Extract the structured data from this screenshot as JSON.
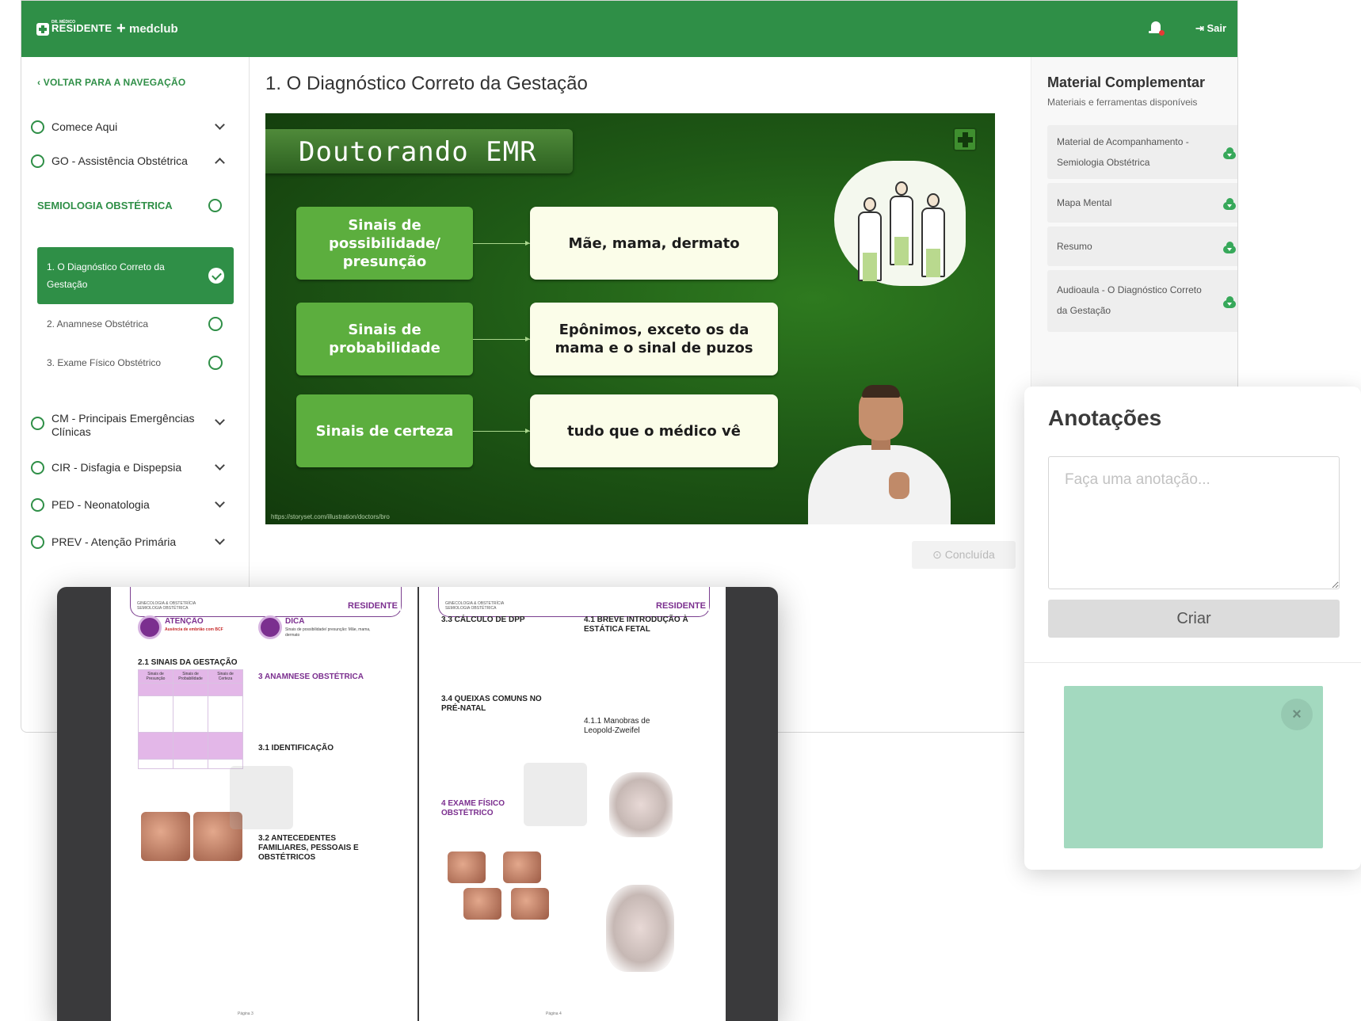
{
  "topbar": {
    "logo_small": "DR. MÉDICO",
    "logo": "RESIDENTE",
    "partner": "medclub",
    "logout": "Sair"
  },
  "sidebar": {
    "back": "VOLTAR PARA A NAVEGAÇÃO",
    "modules": [
      {
        "label": "Comece Aqui"
      },
      {
        "label": "GO - Assistência Obstétrica"
      },
      {
        "label": "CM - Principais Emergências Clínicas"
      },
      {
        "label": "CIR - Disfagia e Dispepsia"
      },
      {
        "label": "PED - Neonatologia"
      },
      {
        "label": "PREV - Atenção Primária"
      }
    ],
    "subsection": "SEMIOLOGIA OBSTÉTRICA",
    "lessons": [
      {
        "label": "1. O Diagnóstico Correto da Gestação",
        "status": "done"
      },
      {
        "label": "2. Anamnese Obstétrica",
        "status": "pending"
      },
      {
        "label": "3. Exame Físico Obstétrico",
        "status": "pending"
      }
    ]
  },
  "main": {
    "title": "1. O Diagnóstico Correto da Gestação",
    "done_button": "Concluída"
  },
  "video": {
    "banner": "Doutorando EMR",
    "rows": [
      {
        "left": "Sinais de possibilidade/ presunção",
        "right": "Mãe, mama, dermato"
      },
      {
        "left": "Sinais de probabilidade",
        "right": "Epônimos, exceto os da mama e o sinal de puzos"
      },
      {
        "left": "Sinais de certeza",
        "right": "tudo que o médico vê"
      }
    ],
    "credit": "https://storyset.com/illustration/doctors/bro"
  },
  "material": {
    "title": "Material Complementar",
    "subtitle": "Materiais e ferramentas disponíveis",
    "items": [
      {
        "label": "Material de Acompanhamento - Semiologia Obstétrica"
      },
      {
        "label": "Mapa Mental"
      },
      {
        "label": "Resumo"
      },
      {
        "label": "Audioaula - O Diagnóstico Correto da Gestação"
      }
    ]
  },
  "notes": {
    "title": "Anotações",
    "placeholder": "Faça uma anotação...",
    "button": "Criar",
    "close": "×"
  },
  "pdf": {
    "crumb": "GINECOLOGIA & OBSTETRÍCIA\nSEMIOLOGIA OBSTÉTRICA",
    "brand": "RESIDENTE",
    "p1": {
      "attention_title": "ATENÇÃO",
      "attention_text": "Ausência de embrião com BCF",
      "tip_title": "DICA",
      "tip_text": "Sinais de possibilidade/ presunção: Mãe, mama, dermato",
      "s21": "2.1  SINAIS DA GESTAÇÃO",
      "table_head": [
        "Sinais de Presunção",
        "Sinais de Probabilidade",
        "Sinais de Certeza"
      ],
      "s3": "3   ANAMNESE OBSTÉTRICA",
      "s31": "3.1  IDENTIFICAÇÃO",
      "s32": "3.2 ANTECEDENTES FAMILIARES, PESSOAIS E OBSTÉTRICOS",
      "footer": "Página 3"
    },
    "p2": {
      "s33": "3.3 CÁLCULO DE DPP",
      "s41": "4.1  BREVE INTRODUÇÃO À ESTÁTICA FETAL",
      "s34": "3.4 QUEIXAS COMUNS NO PRÉ-NATAL",
      "s411": "4.1.1  Manobras de Leopold-Zweifel",
      "s4": "4   EXAME FÍSICO OBSTÉTRICO",
      "footer": "Página 4"
    }
  }
}
